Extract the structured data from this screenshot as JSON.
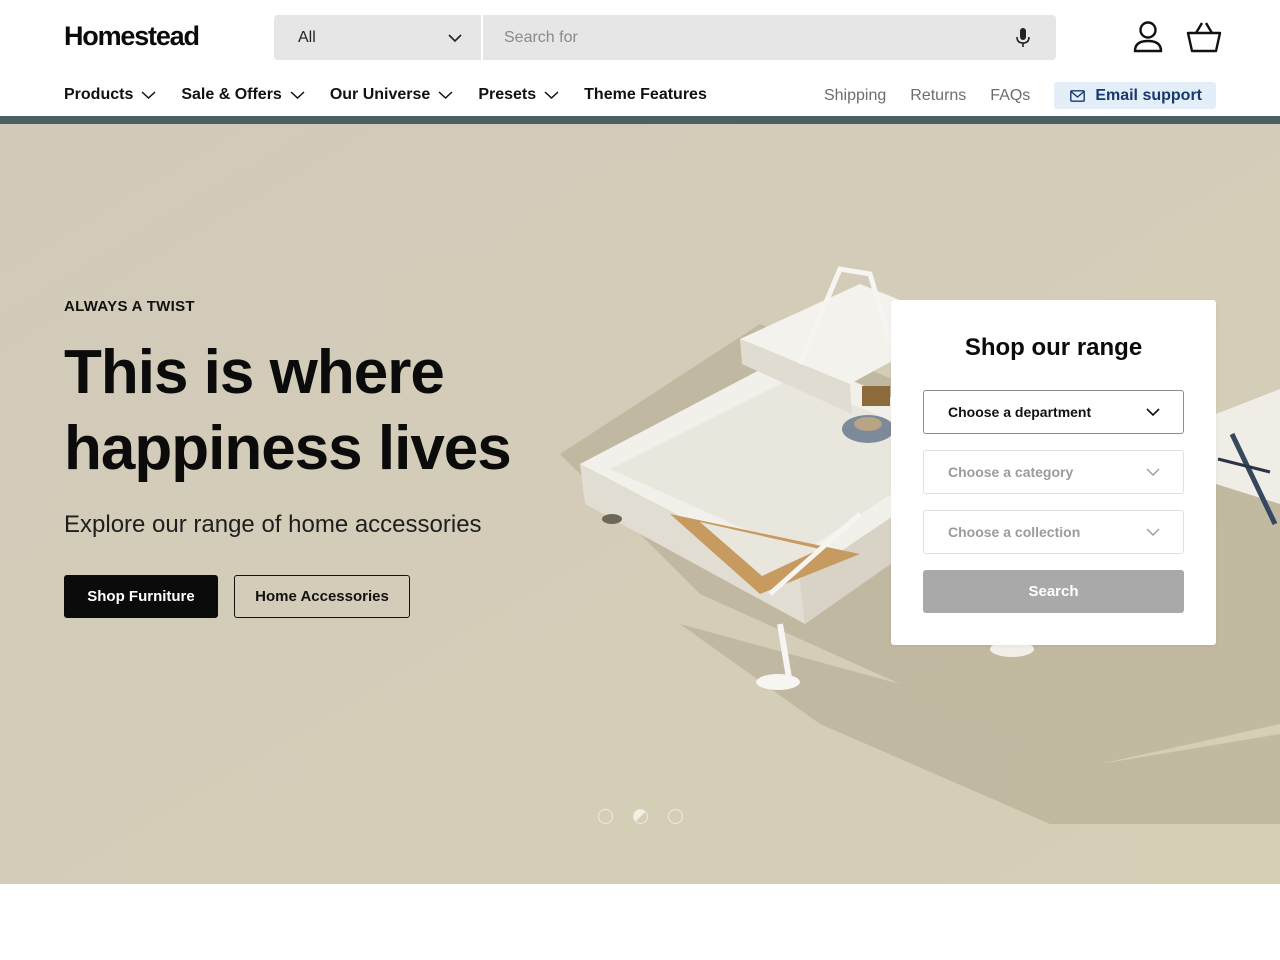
{
  "brand": {
    "logo_text": "Homestead"
  },
  "search": {
    "scope_value": "All",
    "placeholder": "Search for",
    "mic_icon": "microphone-icon"
  },
  "header_icons": {
    "account": "user-icon",
    "cart": "basket-icon"
  },
  "nav": {
    "items": [
      {
        "label": "Products",
        "has_dropdown": true
      },
      {
        "label": "Sale & Offers",
        "has_dropdown": true
      },
      {
        "label": "Our Universe",
        "has_dropdown": true
      },
      {
        "label": "Presets",
        "has_dropdown": true
      },
      {
        "label": "Theme Features",
        "has_dropdown": false
      }
    ],
    "utility_links": [
      "Shipping",
      "Returns",
      "FAQs"
    ],
    "email_support_label": "Email support"
  },
  "hero": {
    "eyebrow": "ALWAYS A TWIST",
    "headline": "This is where happiness lives",
    "subhead": "Explore our range of home accessories",
    "primary_cta": "Shop Furniture",
    "secondary_cta": "Home Accessories",
    "slides_count": 3,
    "active_slide": 2
  },
  "finder": {
    "title": "Shop our range",
    "department_label": "Choose a department",
    "category_label": "Choose a category",
    "collection_label": "Choose a collection",
    "search_label": "Search"
  },
  "colors": {
    "hero_bg": "#d3ccb6",
    "nav_strip": "#4c5f62",
    "email_support_bg": "#e3eef9",
    "email_support_text": "#173a6e",
    "primary_button": "#0b0b0b",
    "disabled_button": "#a9a9a9"
  }
}
